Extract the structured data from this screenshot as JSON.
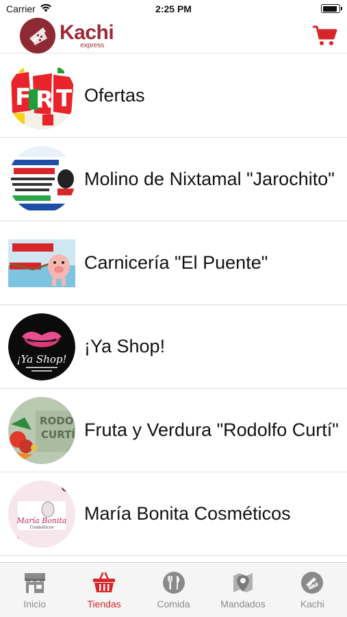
{
  "status_bar": {
    "carrier": "Carrier",
    "time": "2:25 PM",
    "battery_level": 0.9
  },
  "header": {
    "logo_name": "Kachi",
    "logo_sub": "express",
    "cart_icon": "cart-icon",
    "brand_color": "#9b2a36",
    "accent_color": "#d7262a"
  },
  "stores": [
    {
      "name": "Ofertas",
      "icon": "ofertas-banner-image"
    },
    {
      "name": "Molino de Nixtamal \"Jarochito\"",
      "icon": "molino-logo-image"
    },
    {
      "name": "Carnicería \"El Puente\"",
      "icon": "carniceria-logo-image"
    },
    {
      "name": "¡Ya Shop!",
      "icon": "ya-shop-logo-image"
    },
    {
      "name": "Fruta y Verdura \"Rodolfo Curtí\"",
      "icon": "fruta-verdura-logo-image"
    },
    {
      "name": "María Bonita Cosméticos",
      "icon": "maria-bonita-logo-image"
    }
  ],
  "tabs": [
    {
      "label": "Inicio",
      "icon": "store-icon",
      "active": false
    },
    {
      "label": "Tiendas",
      "icon": "basket-icon",
      "active": true
    },
    {
      "label": "Comida",
      "icon": "fork-knife-icon",
      "active": false
    },
    {
      "label": "Mandados",
      "icon": "map-pin-icon",
      "active": false
    },
    {
      "label": "Kachi",
      "icon": "kachi-rider-icon",
      "active": false
    }
  ]
}
